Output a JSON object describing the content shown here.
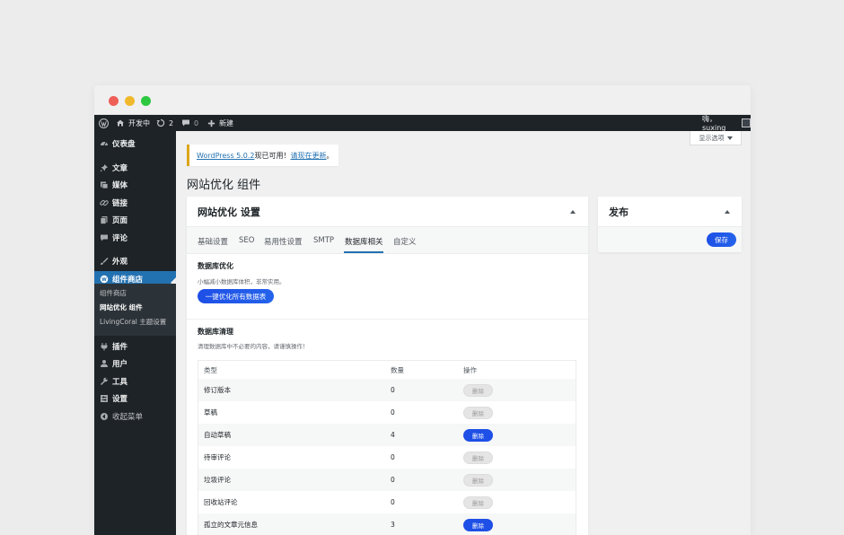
{
  "admin_bar": {
    "site_name": "开发中",
    "updates_count": "2",
    "comments_count": "0",
    "new_label": "新建",
    "greeting": "嗨，suxing"
  },
  "sidebar": {
    "items": [
      {
        "label": "仪表盘",
        "icon": "dashboard-icon"
      },
      {
        "label": "文章",
        "icon": "pin-icon"
      },
      {
        "label": "媒体",
        "icon": "media-icon"
      },
      {
        "label": "链接",
        "icon": "link-icon"
      },
      {
        "label": "页面",
        "icon": "page-icon"
      },
      {
        "label": "评论",
        "icon": "comment-icon"
      },
      {
        "label": "外观",
        "icon": "brush-icon"
      },
      {
        "label": "组件商店",
        "icon": "plugin-store-icon"
      },
      {
        "label": "插件",
        "icon": "plugin-icon"
      },
      {
        "label": "用户",
        "icon": "user-icon"
      },
      {
        "label": "工具",
        "icon": "wrench-icon"
      },
      {
        "label": "设置",
        "icon": "settings-icon"
      },
      {
        "label": "收起菜单",
        "icon": "collapse-icon"
      }
    ],
    "submenu": [
      "组件商店",
      "网站优化 组件",
      "LivingCoral 主题设置"
    ]
  },
  "screen_options": "显示选项",
  "notice": {
    "link1": "WordPress 5.0.2",
    "text": "现已可用！",
    "link2": "请现在更新",
    "end": "。"
  },
  "page_title": "网站优化 组件",
  "panel": {
    "title": "网站优化 设置",
    "tabs": [
      "基础设置",
      "SEO",
      "易用性设置",
      "SMTP",
      "数据库相关",
      "自定义"
    ],
    "active_tab": "数据库相关",
    "optimize": {
      "title": "数据库优化",
      "desc": "小幅减小数据库体积，非常实用。",
      "button": "一键优化所有数据表"
    },
    "cleanup": {
      "title": "数据库清理",
      "desc": "清理数据库中不必要的内容，请谨慎操作！",
      "columns": [
        "类型",
        "数量",
        "操作"
      ],
      "rows": [
        {
          "type": "修订版本",
          "count": "0",
          "action": "删除",
          "enabled": false
        },
        {
          "type": "草稿",
          "count": "0",
          "action": "删除",
          "enabled": false
        },
        {
          "type": "自动草稿",
          "count": "4",
          "action": "删除",
          "enabled": true
        },
        {
          "type": "待审评论",
          "count": "0",
          "action": "删除",
          "enabled": false
        },
        {
          "type": "垃圾评论",
          "count": "0",
          "action": "删除",
          "enabled": false
        },
        {
          "type": "回收站评论",
          "count": "0",
          "action": "删除",
          "enabled": false
        },
        {
          "type": "孤立的文章元信息",
          "count": "3",
          "action": "删除",
          "enabled": true
        }
      ]
    }
  },
  "publish": {
    "title": "发布",
    "save_button": "保存"
  },
  "colors": {
    "admin_bar": "#1d2327",
    "active_menu": "#2271b1",
    "primary_button": "#1e4fe6",
    "notice_border": "#dba617"
  }
}
